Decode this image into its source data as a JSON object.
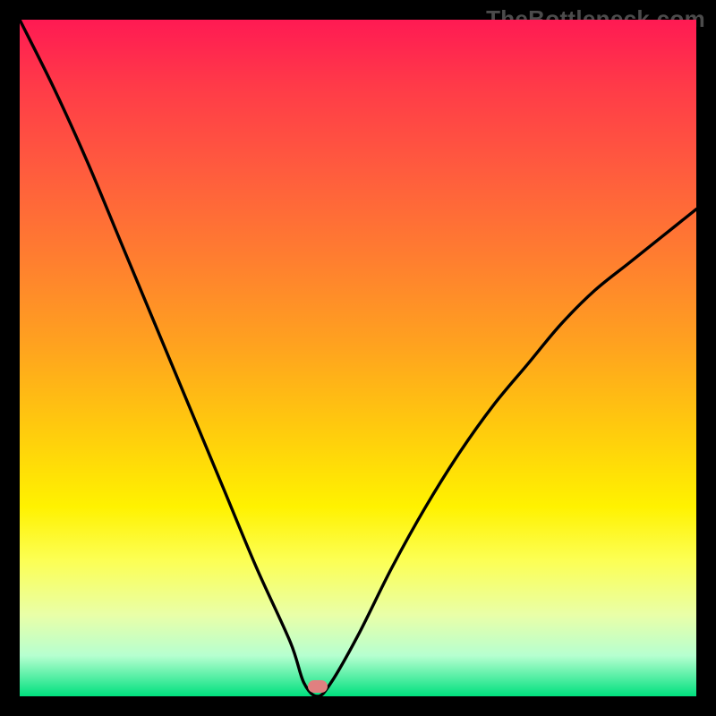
{
  "watermark": "TheBottleneck.com",
  "colors": {
    "frame": "#000000",
    "curve": "#000000",
    "dot": "#e08080",
    "gradient_stops": [
      "#ff1a53",
      "#ff3b48",
      "#ff5b3e",
      "#ff7d30",
      "#ffa21f",
      "#ffc90e",
      "#fff200",
      "#fcff55",
      "#e9ffa8",
      "#b6ffd0",
      "#00e07e"
    ]
  },
  "chart_data": {
    "type": "line",
    "title": "",
    "xlabel": "",
    "ylabel": "",
    "xlim": [
      0,
      100
    ],
    "ylim": [
      0,
      100
    ],
    "x": [
      0,
      5,
      10,
      15,
      20,
      25,
      30,
      35,
      40,
      42,
      44,
      46,
      50,
      55,
      60,
      65,
      70,
      75,
      80,
      85,
      90,
      95,
      100
    ],
    "values": [
      100,
      90,
      79,
      67,
      55,
      43,
      31,
      19,
      8,
      2,
      0,
      2,
      9,
      19,
      28,
      36,
      43,
      49,
      55,
      60,
      64,
      68,
      72
    ],
    "marker": {
      "x": 44,
      "y": 0
    },
    "notes": "V-shaped bottleneck curve; minimum at ~44% on x-axis. Background vertical gradient from red (top) through orange/yellow to green (bottom). Values estimated from pixels."
  }
}
